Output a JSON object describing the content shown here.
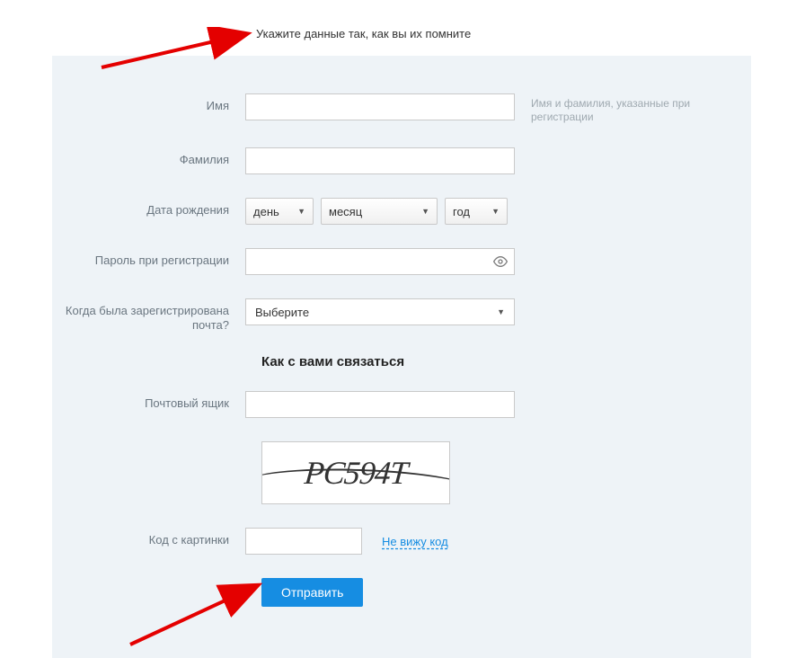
{
  "instruction": "Укажите данные так, как вы их помните",
  "labels": {
    "name": "Имя",
    "surname": "Фамилия",
    "dob": "Дата рождения",
    "password": "Пароль при регистрации",
    "when_registered": "Когда была зарегистрирована почта?",
    "contact_heading": "Как с вами связаться",
    "mailbox": "Почтовый ящик",
    "captcha_code": "Код с картинки"
  },
  "hints": {
    "name": "Имя и фамилия, указанные при регистрации"
  },
  "selects": {
    "day": "день",
    "month": "месяц",
    "year": "год",
    "when_registered": "Выберите"
  },
  "captcha": {
    "text": "PC594T",
    "link": "Не вижу код"
  },
  "buttons": {
    "submit": "Отправить"
  }
}
